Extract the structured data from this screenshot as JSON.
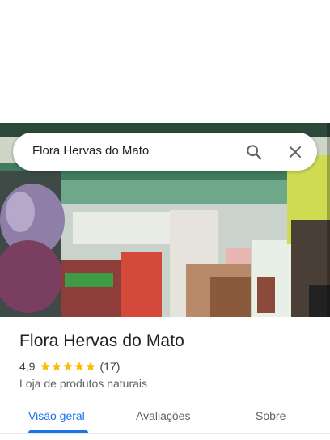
{
  "search": {
    "query": "Flora Hervas do Mato"
  },
  "place": {
    "name": "Flora Hervas do Mato",
    "rating": "4,9",
    "rating_value": 4.9,
    "stars_filled": 5,
    "review_count": "(17)",
    "category": "Loja de produtos naturais"
  },
  "tabs": [
    {
      "label": "Visão geral",
      "active": true
    },
    {
      "label": "Avaliações",
      "active": false
    },
    {
      "label": "Sobre",
      "active": false
    }
  ],
  "colors": {
    "accent": "#1a73e8",
    "star": "#fbbc04",
    "text_primary": "#202124",
    "text_secondary": "#5f6368"
  },
  "icons": {
    "search": "search-icon",
    "close": "close-icon",
    "star": "star-icon"
  }
}
